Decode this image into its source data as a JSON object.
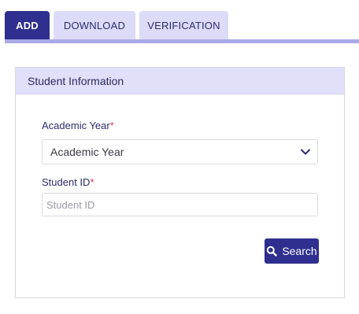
{
  "tabs": [
    {
      "label": "ADD",
      "active": true
    },
    {
      "label": "DOWNLOAD",
      "active": false
    },
    {
      "label": "VERIFICATION",
      "active": false
    }
  ],
  "card": {
    "title": "Student Information"
  },
  "form": {
    "academic_year_label": "Academic Year",
    "academic_year_value": "Academic Year",
    "student_id_label": "Student ID",
    "student_id_placeholder": "Student ID",
    "required_mark": "*"
  },
  "search_button": {
    "label": "Search",
    "icon": "search-icon"
  },
  "colors": {
    "primary": "#2f2f8f",
    "tab_inactive": "#dcdcf8",
    "header_bg": "#e0e0fb",
    "required": "#e0314f"
  }
}
